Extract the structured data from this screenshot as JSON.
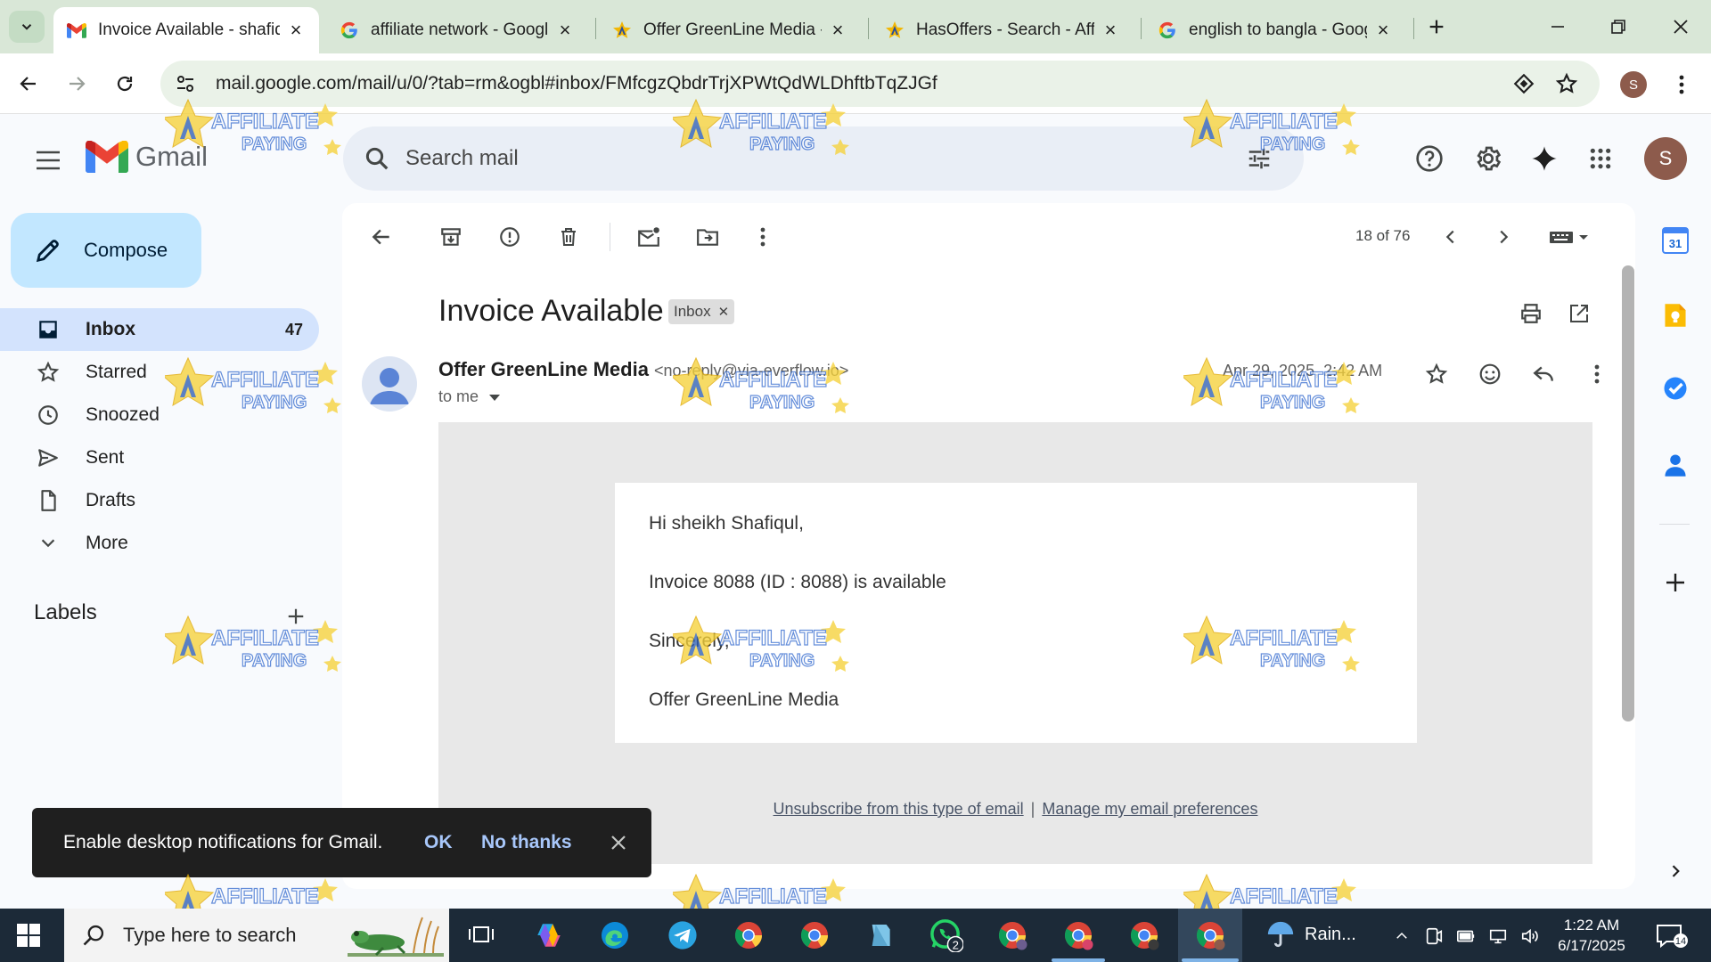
{
  "browser": {
    "tabs": [
      {
        "title": "Invoice Available - shafiqul",
        "active": true
      },
      {
        "title": "affiliate network - Google Search",
        "active": false
      },
      {
        "title": "Offer GreenLine Media - Affiliate",
        "active": false
      },
      {
        "title": "HasOffers - Search - Affpaying",
        "active": false
      },
      {
        "title": "english to bangla - Google Search",
        "active": false
      }
    ],
    "url": "mail.google.com/mail/u/0/?tab=rm&ogbl#inbox/FMfcgzQbdrTrjXPWtQdWLDhftbTqZJGf",
    "profile_initial": "S"
  },
  "gmail": {
    "logo_text": "Gmail",
    "search_placeholder": "Search mail",
    "account_initial": "S",
    "compose_label": "Compose",
    "nav": [
      {
        "label": "Inbox",
        "count": "47",
        "icon": "inbox-icon"
      },
      {
        "label": "Starred",
        "count": "",
        "icon": "star-icon"
      },
      {
        "label": "Snoozed",
        "count": "",
        "icon": "clock-icon"
      },
      {
        "label": "Sent",
        "count": "",
        "icon": "send-icon"
      },
      {
        "label": "Drafts",
        "count": "",
        "icon": "draft-icon"
      },
      {
        "label": "More",
        "count": "",
        "icon": "chevron-down-icon"
      }
    ],
    "labels_heading": "Labels",
    "pager": "18 of 76",
    "email": {
      "subject": "Invoice Available",
      "label_chip": "Inbox",
      "sender_name": "Offer GreenLine Media",
      "sender_email": "<no-reply@via-everflow.io>",
      "recipient": "to me",
      "datetime": "Apr 29, 2025, 2:42 AM",
      "body": {
        "greeting": "Hi sheikh Shafiqul,",
        "line1": "Invoice 8088 (ID : 8088) is available",
        "closing": "Sincerely,",
        "signature": "Offer GreenLine Media"
      },
      "footer": {
        "unsubscribe": "Unsubscribe from this type of email",
        "separator": "|",
        "preferences": "Manage my email preferences"
      }
    },
    "snackbar": {
      "message": "Enable desktop notifications for Gmail.",
      "ok": "OK",
      "no_thanks": "No thanks"
    },
    "side_panel_calendar_day": "31"
  },
  "watermark": {
    "line1": "AFFILIATE",
    "line2": "PAYING"
  },
  "taskbar": {
    "search_placeholder": "Type here to search",
    "whatsapp_badge": "2",
    "weather": "Rain...",
    "time": "1:22 AM",
    "date": "6/17/2025",
    "notification_count": "14"
  },
  "colors": {
    "tabstrip": "#d9e7d7",
    "active_nav": "#d3e3fd",
    "compose": "#c2e7ff",
    "snackbar": "#1f1f1f",
    "snackbar_action": "#a8c7fa",
    "taskbar": "#1c2a38"
  }
}
